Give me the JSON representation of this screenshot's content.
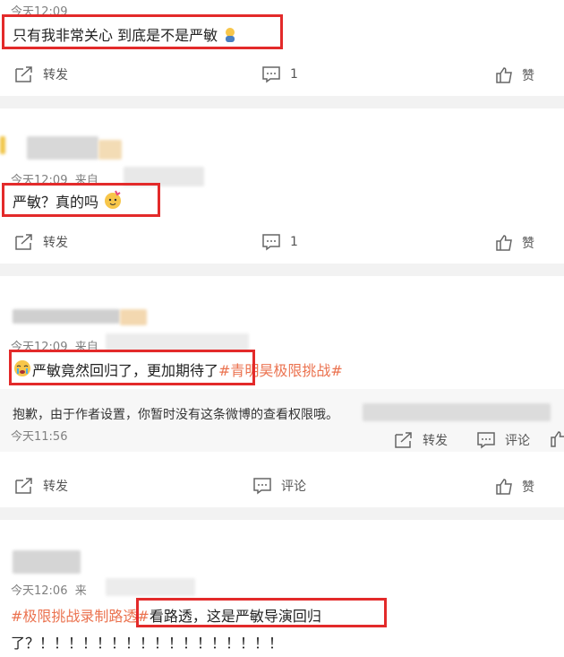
{
  "comments": [
    {
      "time": "今天12:09",
      "text": "只有我非常关心 到底是不是严敏",
      "emoji": "thinking-person",
      "actions": {
        "repost": "转发",
        "comment_count": "1",
        "like": "赞"
      }
    },
    {
      "time": "今天12:09",
      "source_prefix": "来自",
      "text": "严敏？真的吗",
      "emoji": "party-face",
      "actions": {
        "repost": "转发",
        "comment_count": "1",
        "like": "赞"
      }
    },
    {
      "time": "今天12:09",
      "source_prefix": "来自",
      "text": "严敏竟然回归了，更加期待了",
      "hashtag": "#青明昊极限挑战#",
      "emoji": "crying-face",
      "quoted": {
        "text": "抱歉，由于作者设置，你暂时没有这条微博的查看权限哦。",
        "time": "今天11:56",
        "repost": "转发",
        "comment": "评论"
      },
      "actions": {
        "repost": "转发",
        "comment": "评论",
        "like": "赞"
      }
    },
    {
      "time": "今天12:06",
      "source_prefix": "来",
      "hashtag": "#极限挑战录制路透#",
      "text": "看路透，这是严敏导演回归",
      "text_line2": "了？！！！！！！！！！！！！！！！！！"
    }
  ],
  "colors": {
    "highlight": "#e32a2a",
    "hashtag": "#eb7350"
  }
}
